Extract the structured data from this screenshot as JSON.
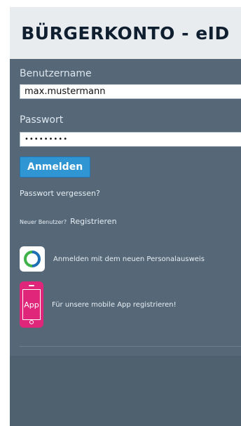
{
  "header": {
    "title": "BÜRGERKONTO - eID"
  },
  "login": {
    "username_label": "Benutzername",
    "username_value": "max.mustermann",
    "password_label": "Passwort",
    "password_value": "•••••••••",
    "submit_label": "Anmelden",
    "forgot_password": "Passwort vergessen?",
    "new_user_prefix": "Neuer Benutzer?",
    "register_link": "Registrieren"
  },
  "options": {
    "eid_text": "Anmelden mit dem neuen Personalausweis",
    "app_icon_label": "App",
    "app_text": "Für unsere mobile App registrieren!"
  },
  "colors": {
    "panel_bg": "#566878",
    "header_bg": "#e9ecef",
    "button_bg": "#2f95d3",
    "app_icon_bg": "#e0267a",
    "eid_icon_green": "#3fb24a",
    "eid_icon_blue": "#1f6fb5"
  },
  "icons": {
    "eid": "personalausweis-eid-icon",
    "app": "mobile-phone-icon"
  }
}
